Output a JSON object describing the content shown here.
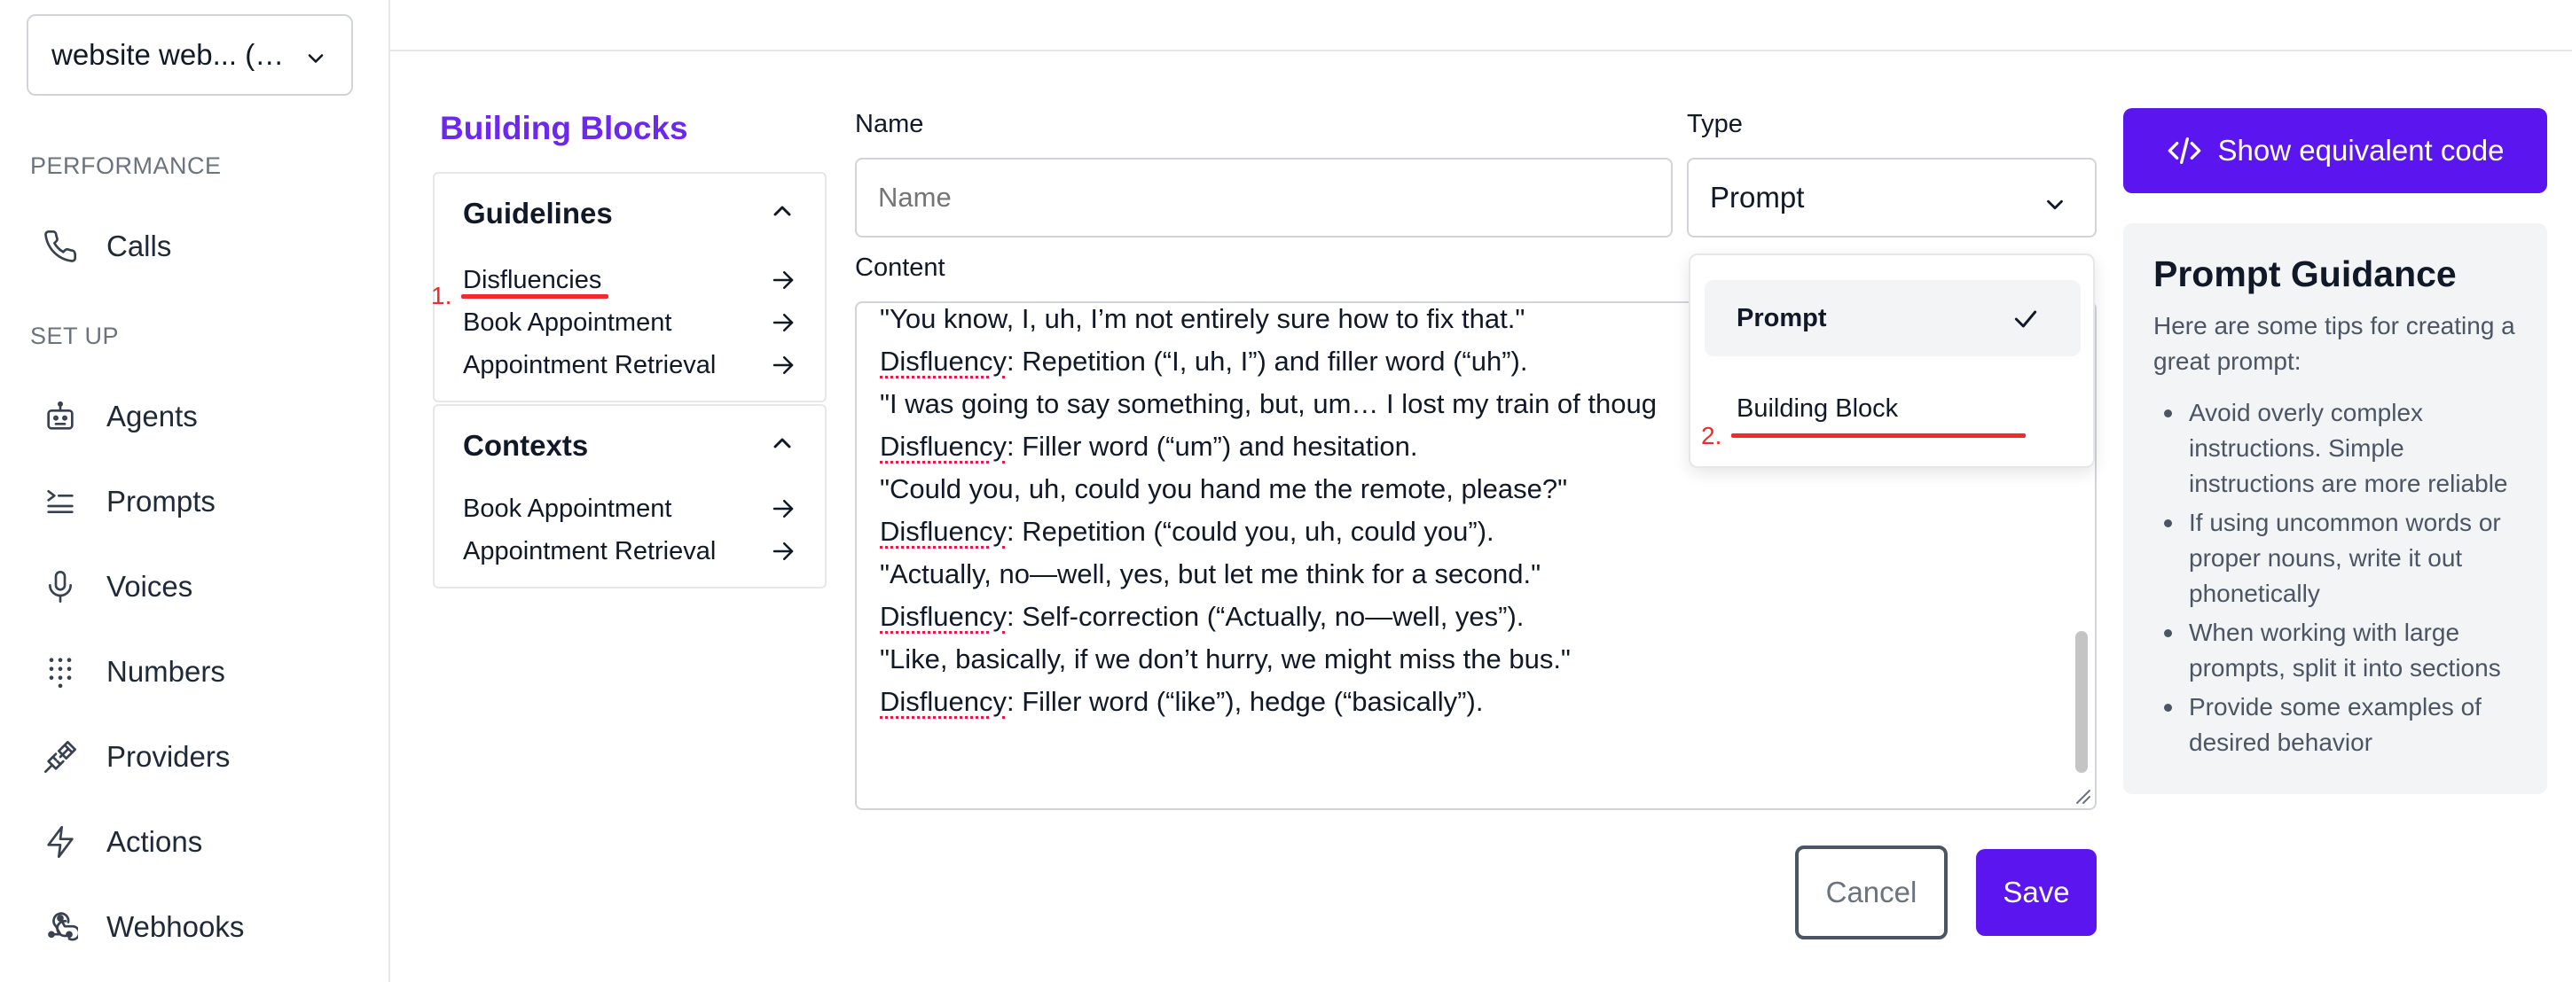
{
  "workspace": {
    "label": "website web... (…"
  },
  "sidebar": {
    "sections": [
      {
        "label": "PERFORMANCE"
      },
      {
        "label": "SET UP"
      }
    ],
    "items": [
      {
        "label": "Calls",
        "icon": "phone-icon"
      },
      {
        "label": "Agents",
        "icon": "robot-icon"
      },
      {
        "label": "Prompts",
        "icon": "prompt-list-icon"
      },
      {
        "label": "Voices",
        "icon": "microphone-icon"
      },
      {
        "label": "Numbers",
        "icon": "dialpad-icon"
      },
      {
        "label": "Providers",
        "icon": "plug-icon"
      },
      {
        "label": "Actions",
        "icon": "lightning-icon"
      },
      {
        "label": "Webhooks",
        "icon": "webhook-icon"
      }
    ]
  },
  "building_blocks": {
    "title": "Building Blocks",
    "guidelines": {
      "title": "Guidelines",
      "items": [
        "Disfluencies",
        "Book Appointment",
        "Appointment Retrieval"
      ]
    },
    "contexts": {
      "title": "Contexts",
      "items": [
        "Book Appointment",
        "Appointment Retrieval"
      ]
    }
  },
  "annotations": {
    "first": "1.",
    "second": "2."
  },
  "form": {
    "name_label": "Name",
    "name_placeholder": "Name",
    "type_label": "Type",
    "type_value": "Prompt",
    "content_label": "Content",
    "content_lines": [
      {
        "prefix": "",
        "text": "\"You know, I, uh, I’m not entirely sure how to fix that.\""
      },
      {
        "prefix": "Disfluency",
        "text": ": Repetition (“I, uh, I”) and filler word (“uh”)."
      },
      {
        "prefix": "",
        "text": "\"I was going to say something, but, um… I lost my train of thoug"
      },
      {
        "prefix": "Disfluency",
        "text": ": Filler word (“um”) and hesitation."
      },
      {
        "prefix": "",
        "text": "\"Could you, uh, could you hand me the remote, please?\""
      },
      {
        "prefix": "Disfluency",
        "text": ": Repetition (“could you, uh, could you”)."
      },
      {
        "prefix": "",
        "text": "\"Actually, no—well, yes, but let me think for a second.\""
      },
      {
        "prefix": "Disfluency",
        "text": ": Self-correction (“Actually, no—well, yes”)."
      },
      {
        "prefix": "",
        "text": "\"Like, basically, if we don’t hurry, we might miss the bus.\""
      },
      {
        "prefix": "Disfluency",
        "text": ": Filler word (“like”), hedge (“basically”)."
      }
    ]
  },
  "type_dropdown": {
    "options": [
      {
        "label": "Prompt",
        "selected": true
      },
      {
        "label": "Building Block",
        "selected": false
      }
    ]
  },
  "buttons": {
    "cancel": "Cancel",
    "save": "Save",
    "show_code": "Show equivalent code"
  },
  "guidance": {
    "title": "Prompt Guidance",
    "intro": "Here are some tips for creating a great prompt:",
    "tips": [
      "Avoid overly complex instructions. Simple instructions are more reliable",
      "If using uncommon words or proper nouns, write it out phonetically",
      "When working with large prompts, split it into sections",
      "Provide some examples of desired behavior"
    ]
  },
  "colors": {
    "accent": "#5b16f0",
    "title_purple": "#6d28f0",
    "annotation_red": "#ef2b2b"
  }
}
